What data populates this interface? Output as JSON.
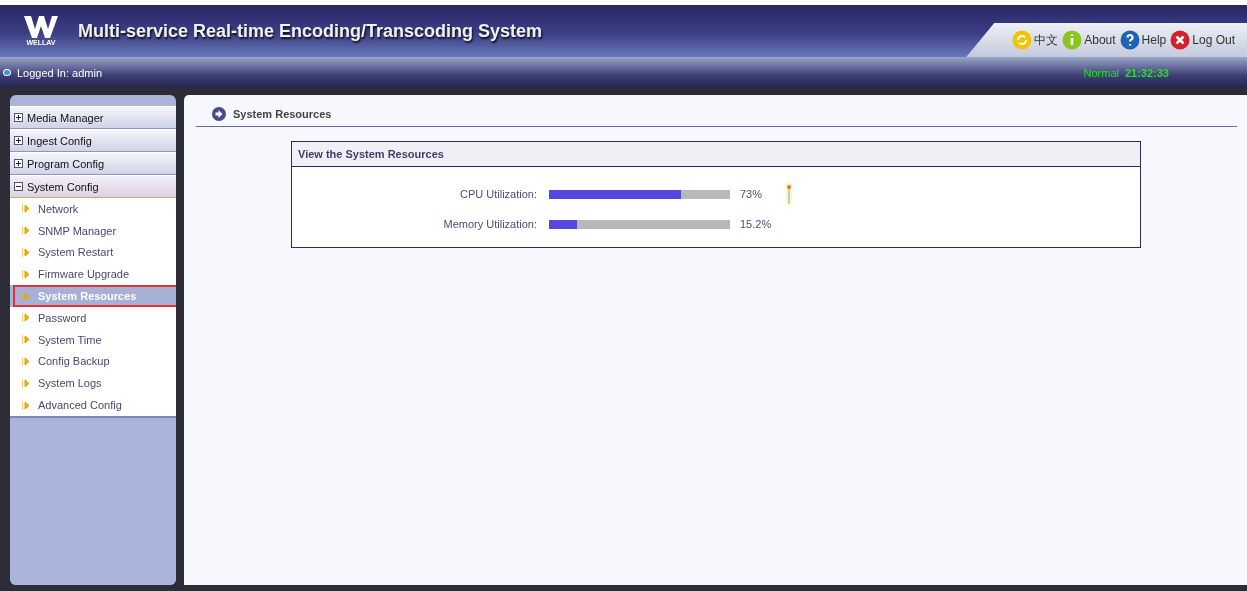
{
  "header": {
    "logo_text": "WELLAV",
    "title": "Multi-service Real-time Encoding/Transcoding System",
    "links": [
      {
        "kind": "language",
        "label": "中文"
      },
      {
        "kind": "about",
        "label": "About"
      },
      {
        "kind": "help",
        "label": "Help"
      },
      {
        "kind": "logout",
        "label": "Log Out"
      }
    ]
  },
  "status_bar": {
    "user": "Logged In: admin",
    "state": "Normal",
    "time": "21:32:33"
  },
  "sidebar": {
    "groups": [
      {
        "label": "Media Manager",
        "expanded": false
      },
      {
        "label": "Ingest Config",
        "expanded": false
      },
      {
        "label": "Program Config",
        "expanded": false
      },
      {
        "label": "System Config",
        "expanded": true,
        "children": [
          {
            "label": "Network",
            "selected": false
          },
          {
            "label": "SNMP Manager",
            "selected": false
          },
          {
            "label": "System Restart",
            "selected": false
          },
          {
            "label": "Firmware Upgrade",
            "selected": false
          },
          {
            "label": "System Resources",
            "selected": true
          },
          {
            "label": "Password",
            "selected": false
          },
          {
            "label": "System Time",
            "selected": false
          },
          {
            "label": "Config Backup",
            "selected": false
          },
          {
            "label": "System Logs",
            "selected": false
          },
          {
            "label": "Advanced Config",
            "selected": false
          }
        ]
      }
    ]
  },
  "page": {
    "title": "System Resources",
    "panel_title": "View the System Resources",
    "meters": [
      {
        "label": "CPU Utilization:",
        "level": 0.73,
        "reading": "73%"
      },
      {
        "label": "Memory Utilization:",
        "level": 0.152,
        "reading": "15.2%"
      }
    ]
  }
}
